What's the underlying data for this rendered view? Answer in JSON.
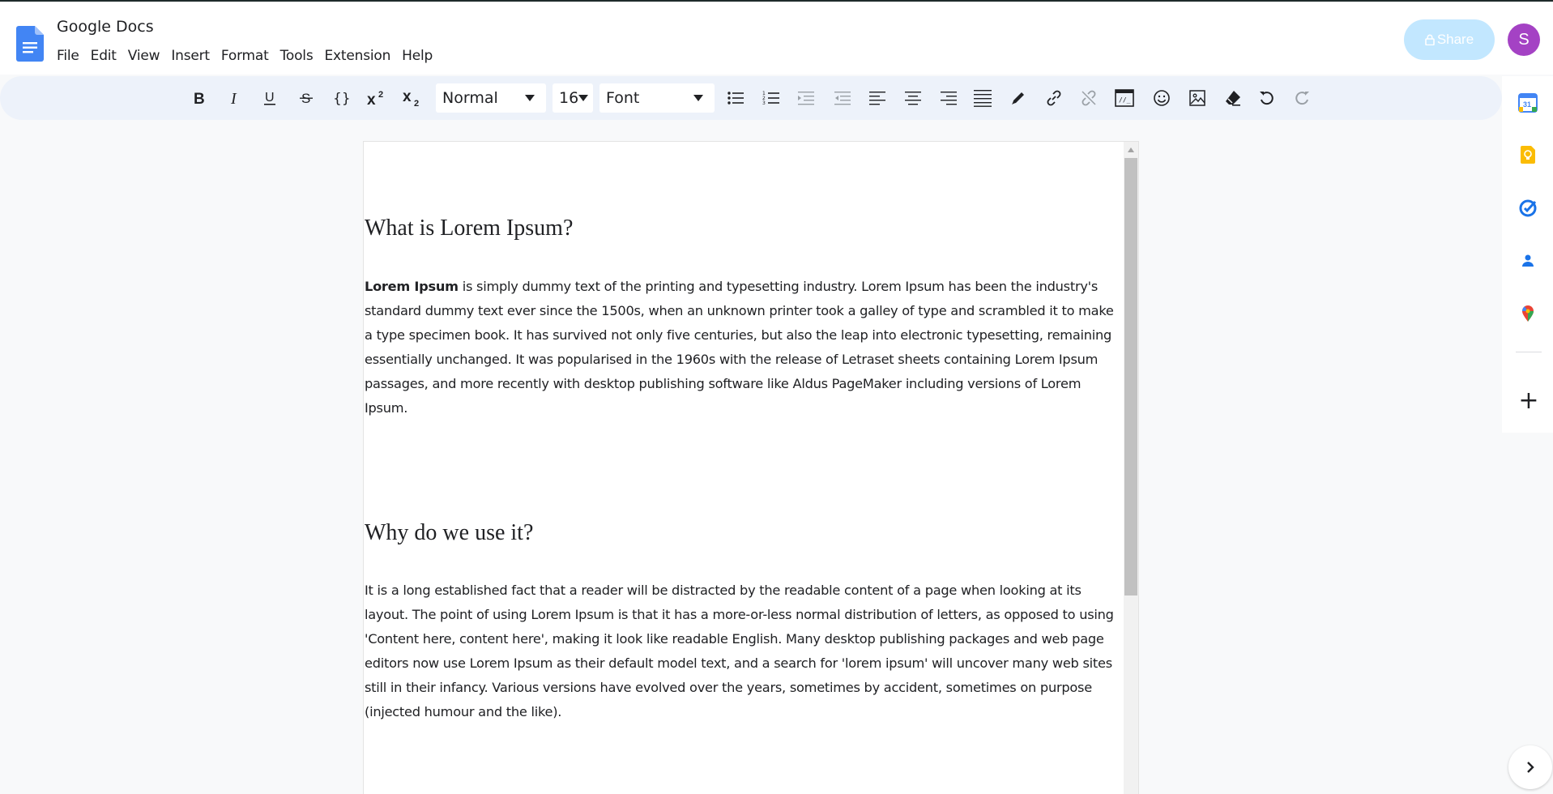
{
  "app": {
    "title": "Google Docs",
    "menu": [
      "File",
      "Edit",
      "View",
      "Insert",
      "Format",
      "Tools",
      "Extension",
      "Help"
    ],
    "share_label": "Share",
    "avatar_initial": "S"
  },
  "toolbar": {
    "style_value": "Normal",
    "font_size_value": "16",
    "font_value": "Font"
  },
  "document": {
    "sections": [
      {
        "heading": "What is Lorem Ipsum?",
        "lead_bold": "Lorem Ipsum",
        "body": " is simply dummy text of the printing and typesetting industry. Lorem Ipsum has been the industry's standard dummy text ever since the 1500s, when an unknown printer took a galley of type and scrambled it to make a type specimen book. It has survived not only five centuries, but also the leap into electronic typesetting, remaining essentially unchanged. It was popularised in the 1960s with the release of Letraset sheets containing Lorem Ipsum passages, and more recently with desktop publishing software like Aldus PageMaker including versions of Lorem Ipsum."
      },
      {
        "heading": "Why do we use it?",
        "body": "It is a long established fact that a reader will be distracted by the readable content of a page when looking at its layout. The point of using Lorem Ipsum is that it has a more-or-less normal distribution of letters, as opposed to using 'Content here, content here', making it look like readable English. Many desktop publishing packages and web page editors now use Lorem Ipsum as their default model text, and a search for 'lorem ipsum' will uncover many web sites still in their infancy. Various versions have evolved over the years, sometimes by accident, sometimes on purpose (injected humour and the like)."
      }
    ]
  },
  "side_panel": {
    "calendar_day": "31"
  },
  "colors": {
    "share_bg": "#c2e7ff",
    "avatar_bg": "#a442c4",
    "toolbar_bg": "#edf2fa",
    "doc_blue": "#4285f4"
  }
}
